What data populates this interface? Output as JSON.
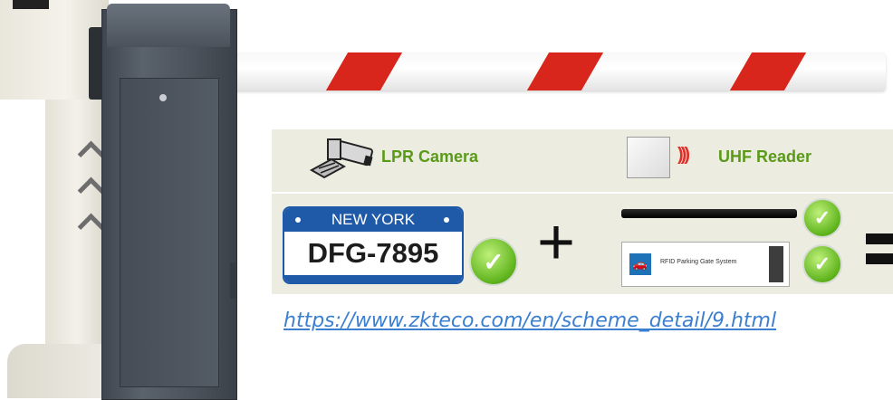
{
  "panel": {
    "camera_label": "LPR Camera",
    "reader_label": "UHF Reader"
  },
  "plate": {
    "state": "NEW YORK",
    "number": "DFG-7895"
  },
  "rfid_card": {
    "text": "RFID Parking Gate System"
  },
  "link": {
    "url": "https://www.zkteco.com/en/scheme_detail/9.html"
  },
  "colors": {
    "accent_green": "#5a9a18",
    "stripe_red": "#d9261c",
    "plate_blue": "#1f5aa8",
    "link_blue": "#3a7fd0",
    "panel_bg": "#ecede0"
  }
}
